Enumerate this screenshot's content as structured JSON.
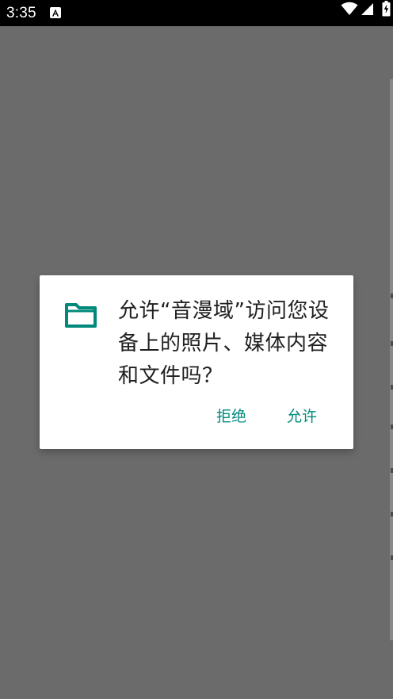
{
  "status_bar": {
    "time": "3:35",
    "notification_icon": "a-badge-icon",
    "icons": [
      "wifi-icon",
      "signal-icon",
      "battery-charging-icon"
    ]
  },
  "dialog": {
    "icon": "folder-icon",
    "message": "允许“音漫域”访问您设备上的照片、媒体内容和文件吗？",
    "deny_label": "拒绝",
    "allow_label": "允许",
    "accent_color": "#00897b"
  },
  "colors": {
    "scrim": "#6b6b6b",
    "status_bar": "#000000",
    "dialog_background": "#ffffff",
    "text": "#202020"
  }
}
